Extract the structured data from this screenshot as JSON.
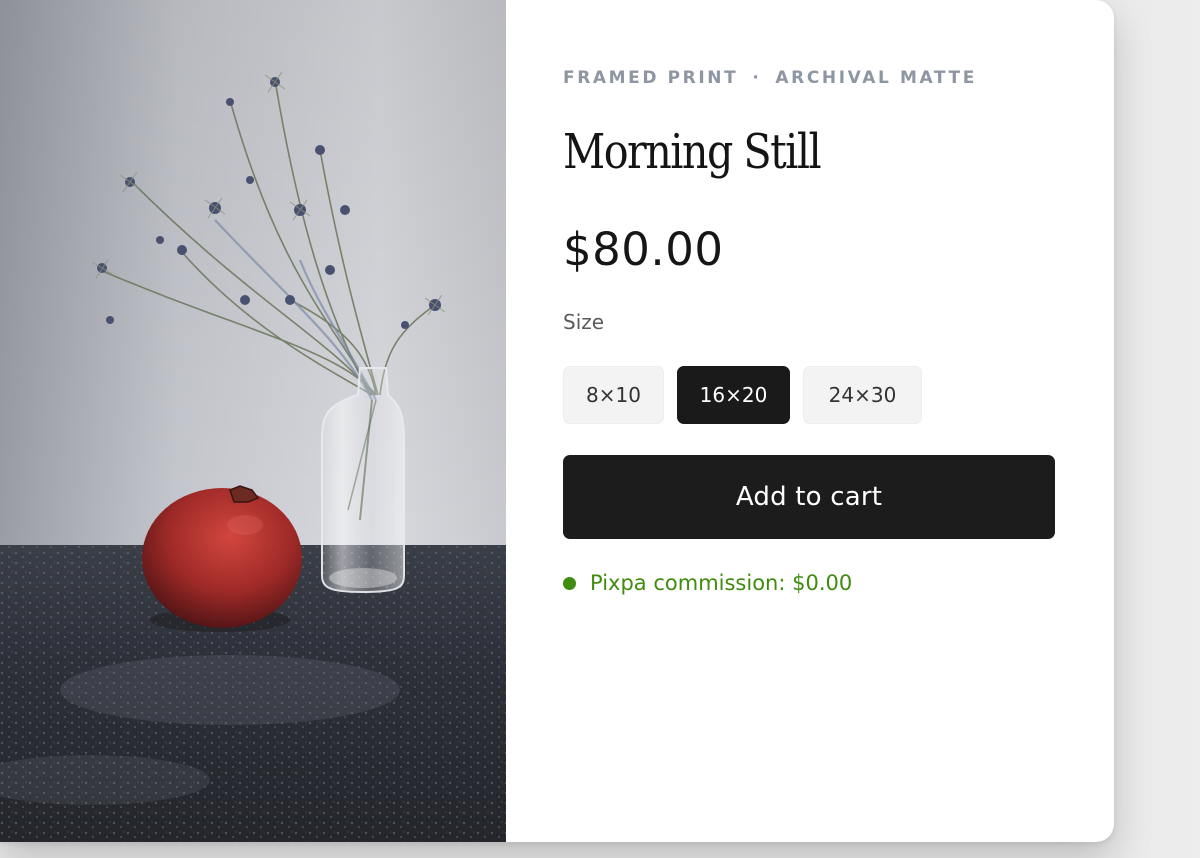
{
  "product": {
    "eyebrow_type": "FRAMED PRINT",
    "eyebrow_separator": "·",
    "eyebrow_finish": "ARCHIVAL MATTE",
    "title": "Morning Still",
    "price": "$80.00",
    "size_label": "Size",
    "sizes": [
      "8×10",
      "16×20",
      "24×30"
    ],
    "selected_size": "16×20",
    "add_to_cart_label": "Add to cart",
    "commission_text": "Pixpa commission: $0.00"
  },
  "colors": {
    "accent_dark": "#1c1c1c",
    "eyebrow": "#8f96a3",
    "status_green": "#3f8c0e",
    "option_bg": "#f3f3f4"
  },
  "icons": {
    "status": "status-dot-icon"
  }
}
